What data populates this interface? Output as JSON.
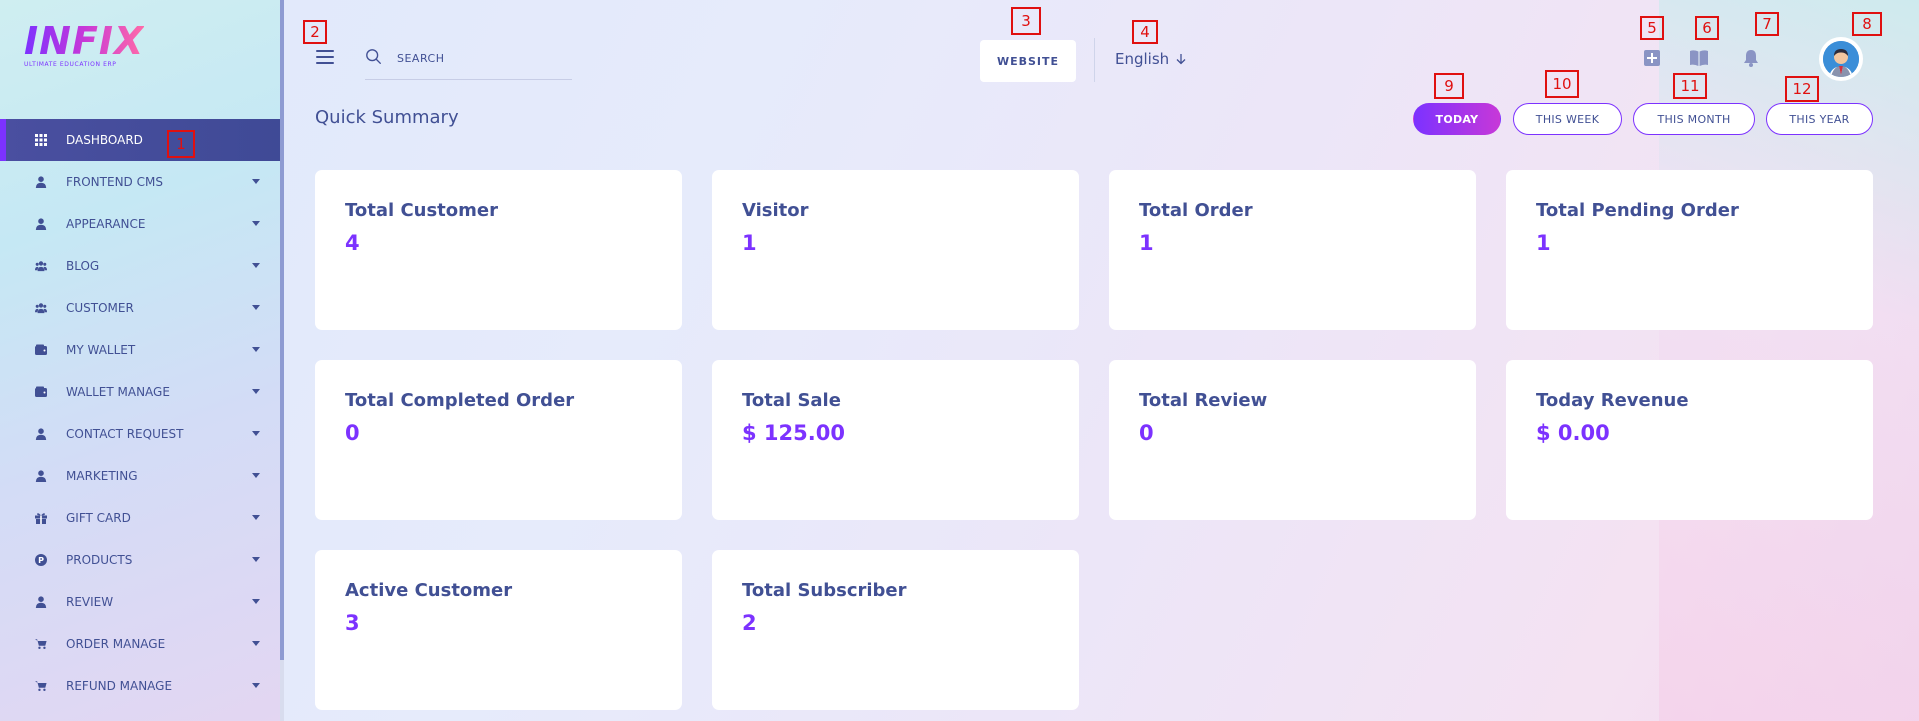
{
  "logo": {
    "text": "INFIX",
    "subtitle": "ULTIMATE EDUCATION ERP"
  },
  "sidebar": {
    "items": [
      {
        "label": "DASHBOARD",
        "icon": "dashboard-icon",
        "active": true
      },
      {
        "label": "FRONTEND CMS",
        "icon": "user-icon"
      },
      {
        "label": "APPEARANCE",
        "icon": "user-icon"
      },
      {
        "label": "BLOG",
        "icon": "users-icon"
      },
      {
        "label": "CUSTOMER",
        "icon": "users-icon"
      },
      {
        "label": "MY WALLET",
        "icon": "wallet-icon"
      },
      {
        "label": "WALLET MANAGE",
        "icon": "wallet-icon"
      },
      {
        "label": "CONTACT REQUEST",
        "icon": "user-icon"
      },
      {
        "label": "MARKETING",
        "icon": "user-icon"
      },
      {
        "label": "GIFT CARD",
        "icon": "gift-icon"
      },
      {
        "label": "PRODUCTS",
        "icon": "product-icon"
      },
      {
        "label": "REVIEW",
        "icon": "user-icon"
      },
      {
        "label": "ORDER MANAGE",
        "icon": "cart-icon"
      },
      {
        "label": "REFUND MANAGE",
        "icon": "cart-icon"
      }
    ]
  },
  "header": {
    "search_placeholder": "SEARCH",
    "website_label": "WEBSITE",
    "language": "English"
  },
  "summary": {
    "title": "Quick Summary",
    "filters": [
      "TODAY",
      "THIS WEEK",
      "THIS MONTH",
      "THIS YEAR"
    ],
    "active_filter": "TODAY",
    "cards": [
      {
        "label": "Total Customer",
        "value": "4"
      },
      {
        "label": "Visitor",
        "value": "1"
      },
      {
        "label": "Total Order",
        "value": "1"
      },
      {
        "label": "Total Pending Order",
        "value": "1"
      },
      {
        "label": "Total Completed Order",
        "value": "0"
      },
      {
        "label": "Total Sale",
        "value": "$ 125.00"
      },
      {
        "label": "Total Review",
        "value": "0"
      },
      {
        "label": "Today Revenue",
        "value": "$ 0.00"
      },
      {
        "label": "Active Customer",
        "value": "3"
      },
      {
        "label": "Total Subscriber",
        "value": "2"
      }
    ]
  },
  "markers": [
    "1",
    "2",
    "3",
    "4",
    "5",
    "6",
    "7",
    "8",
    "9",
    "10",
    "11",
    "12"
  ],
  "colors": {
    "accent": "#7c32ff",
    "text": "#415094",
    "active_bg": "#3f4a96",
    "marker": "#e01010"
  }
}
